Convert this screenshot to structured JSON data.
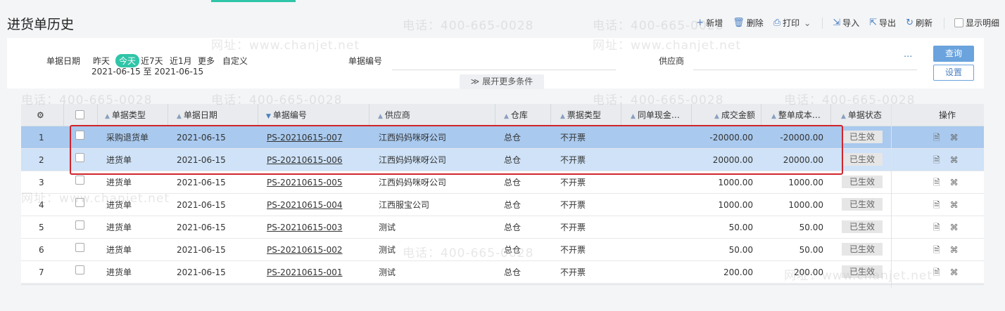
{
  "page_title": "进货单历史",
  "toolbar": {
    "new_label": "新增",
    "delete_label": "删除",
    "print_label": "打印",
    "import_label": "导入",
    "export_label": "导出",
    "refresh_label": "刷新",
    "show_detail_label": "显示明细"
  },
  "filter": {
    "date_label": "单据日期",
    "date_options": [
      "昨天",
      "今天",
      "近7天",
      "近1月",
      "更多",
      "自定义"
    ],
    "active_date_option": "今天",
    "date_range": "2021-06-15 至 2021-06-15",
    "doc_no_label": "单据编号",
    "supplier_label": "供应商",
    "supplier_more": "···",
    "query_label": "查询",
    "settings_label": "设置",
    "expand_label": "展开更多条件"
  },
  "table": {
    "headers": {
      "doc_type": "单据类型",
      "doc_date": "单据日期",
      "doc_no": "单据编号",
      "supplier": "供应商",
      "warehouse": "仓库",
      "invoice_type": "票据类型",
      "same_cash": "同单现金…",
      "deal_amount": "成交金额",
      "total_cost": "整单成本…",
      "doc_status": "单据状态",
      "ops": "操作"
    },
    "rows": [
      {
        "idx": "1",
        "doc_type": "采购退货单",
        "date": "2021-06-15",
        "no": "PS-20210615-007",
        "supplier": "江西妈妈咪呀公司",
        "warehouse": "总仓",
        "invoice": "不开票",
        "amount": "-20000.00",
        "cost": "-20000.00",
        "status": "已生效"
      },
      {
        "idx": "2",
        "doc_type": "进货单",
        "date": "2021-06-15",
        "no": "PS-20210615-006",
        "supplier": "江西妈妈咪呀公司",
        "warehouse": "总仓",
        "invoice": "不开票",
        "amount": "20000.00",
        "cost": "20000.00",
        "status": "已生效"
      },
      {
        "idx": "3",
        "doc_type": "进货单",
        "date": "2021-06-15",
        "no": "PS-20210615-005",
        "supplier": "江西妈妈咪呀公司",
        "warehouse": "总仓",
        "invoice": "不开票",
        "amount": "1000.00",
        "cost": "1000.00",
        "status": "已生效"
      },
      {
        "idx": "4",
        "doc_type": "进货单",
        "date": "2021-06-15",
        "no": "PS-20210615-004",
        "supplier": "江西服宝公司",
        "warehouse": "总仓",
        "invoice": "不开票",
        "amount": "1000.00",
        "cost": "1000.00",
        "status": "已生效"
      },
      {
        "idx": "5",
        "doc_type": "进货单",
        "date": "2021-06-15",
        "no": "PS-20210615-003",
        "supplier": "测试",
        "warehouse": "总仓",
        "invoice": "不开票",
        "amount": "50.00",
        "cost": "50.00",
        "status": "已生效"
      },
      {
        "idx": "6",
        "doc_type": "进货单",
        "date": "2021-06-15",
        "no": "PS-20210615-002",
        "supplier": "测试",
        "warehouse": "总仓",
        "invoice": "不开票",
        "amount": "50.00",
        "cost": "50.00",
        "status": "已生效"
      },
      {
        "idx": "7",
        "doc_type": "进货单",
        "date": "2021-06-15",
        "no": "PS-20210615-001",
        "supplier": "测试",
        "warehouse": "总仓",
        "invoice": "不开票",
        "amount": "200.00",
        "cost": "200.00",
        "status": "已生效"
      }
    ]
  },
  "watermark": {
    "phone": "电话：400-665-0028",
    "site": "网址：www.chanjet.net"
  },
  "colors": {
    "accent": "#2fc5a8",
    "primary_blue": "#6aa3dd",
    "selected_row": "#a9c9ee",
    "selected_row_light": "#cfe2f7",
    "highlight_red": "#d0242c"
  }
}
